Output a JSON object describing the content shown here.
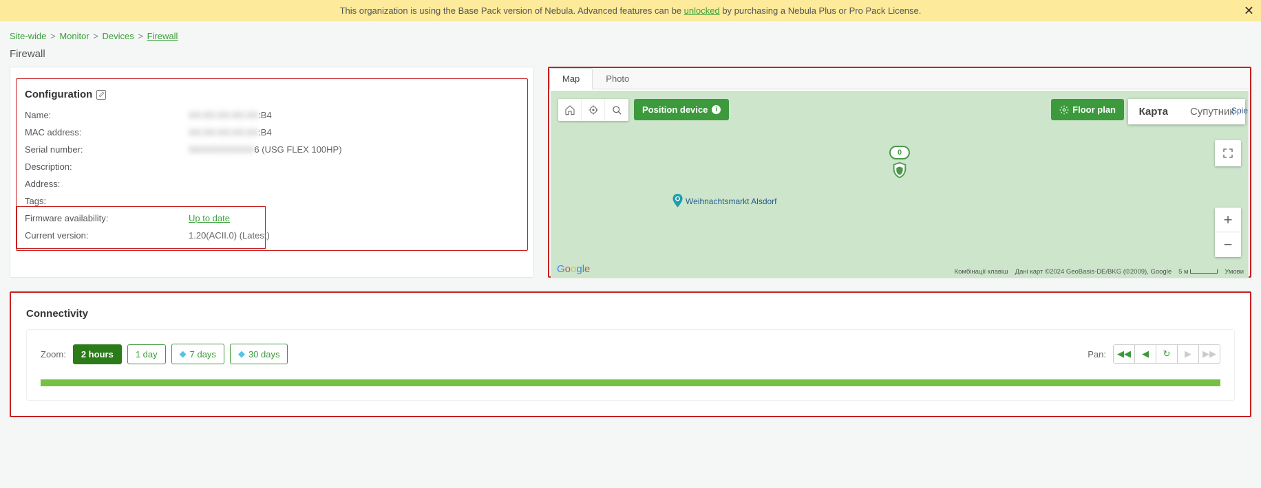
{
  "banner": {
    "pre": "This organization is using the Base Pack version of Nebula. Advanced features can be ",
    "link": "unlocked",
    "post": " by purchasing a Nebula Plus or Pro Pack License."
  },
  "breadcrumb": {
    "items": [
      "Site-wide",
      "Monitor",
      "Devices"
    ],
    "current": "Firewall"
  },
  "page_title": "Firewall",
  "config": {
    "title": "Configuration",
    "rows": {
      "name": {
        "label": "Name:",
        "blur": "XX:XX:XX:XX:XX",
        "suffix": ":B4"
      },
      "mac": {
        "label": "MAC address:",
        "blur": "XX:XX:XX:XX:XX",
        "suffix": ":B4"
      },
      "serial": {
        "label": "Serial number:",
        "blur": "SXXXXXXXXXX",
        "suffix": "6 (USG FLEX 100HP)"
      },
      "description": {
        "label": "Description:",
        "value": ""
      },
      "address": {
        "label": "Address:",
        "value": ""
      },
      "tags": {
        "label": "Tags:",
        "value": ""
      },
      "fw_avail": {
        "label": "Firmware availability:",
        "value": "Up to date"
      },
      "version": {
        "label": "Current version:",
        "value": "1.20(ACII.0) (Latest)"
      }
    }
  },
  "map": {
    "tabs": {
      "map": "Map",
      "photo": "Photo"
    },
    "position_device": "Position device",
    "floor_plan": "Floor plan",
    "map_type": {
      "karta": "Карта",
      "sat": "Супутник"
    },
    "marker_badge": "0",
    "poi": "Weihnachtsmarkt Alsdorf",
    "spie": "Spie",
    "footer": {
      "shortcuts": "Комбінації клавіш",
      "data": "Дані карт ©2024 GeoBasis-DE/BKG (©2009), Google",
      "scale": "5 м",
      "terms": "Умови"
    }
  },
  "connectivity": {
    "title": "Connectivity",
    "zoom_label": "Zoom:",
    "options": {
      "h2": "2 hours",
      "d1": "1 day",
      "d7": "7 days",
      "d30": "30 days"
    },
    "pan_label": "Pan:"
  }
}
